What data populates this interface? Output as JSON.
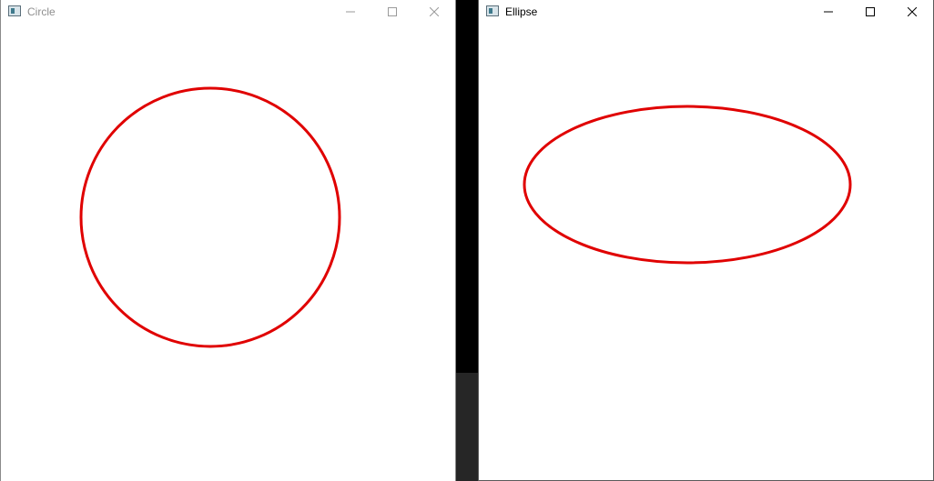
{
  "windows": {
    "circle": {
      "title": "Circle",
      "shape": "circle",
      "stroke_color": "#e00000",
      "icon": "app-window-icon"
    },
    "ellipse": {
      "title": "Ellipse",
      "shape": "ellipse",
      "stroke_color": "#e00000",
      "icon": "app-window-icon"
    }
  },
  "colors": {
    "desktop": "#000000",
    "window_bg": "#ffffff",
    "shape_stroke": "#e00000"
  }
}
